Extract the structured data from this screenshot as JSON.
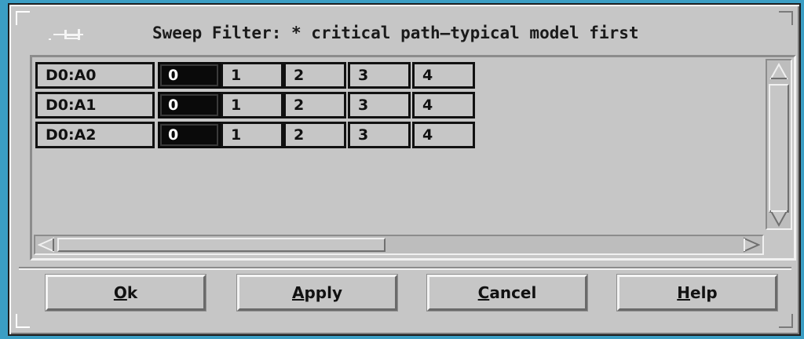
{
  "window": {
    "title": "Sweep Filter: * critical path–typical model first"
  },
  "rows": [
    {
      "label": "D0:A0",
      "values": [
        "0",
        "1",
        "2",
        "3",
        "4"
      ],
      "selected": "0"
    },
    {
      "label": "D0:A1",
      "values": [
        "0",
        "1",
        "2",
        "3",
        "4"
      ],
      "selected": "0"
    },
    {
      "label": "D0:A2",
      "values": [
        "0",
        "1",
        "2",
        "3",
        "4"
      ],
      "selected": "0"
    }
  ],
  "buttons": {
    "ok": {
      "mnemonic": "O",
      "rest": "k"
    },
    "apply": {
      "mnemonic": "A",
      "rest": "pply"
    },
    "cancel": {
      "mnemonic": "C",
      "rest": "ancel"
    },
    "help": {
      "mnemonic": "H",
      "rest": "elp"
    }
  },
  "icons": {
    "title_pin": "pushpin-icon",
    "scroll_up": "arrow-up-icon",
    "scroll_down": "arrow-down-icon",
    "scroll_left": "arrow-left-icon",
    "scroll_right": "arrow-right-icon"
  },
  "colors": {
    "desktop": "#3b9ec4",
    "window_bg": "#c6c6c6",
    "selected_cell": "#0a0a0a"
  }
}
